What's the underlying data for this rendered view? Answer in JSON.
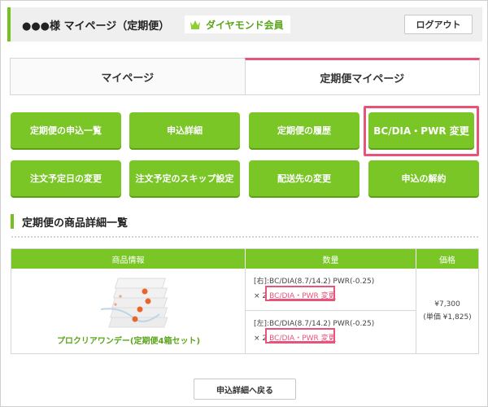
{
  "header": {
    "user_title": "●●●様 マイページ（定期便）",
    "rank_label": "ダイヤモンド会員",
    "rank_icon": "crown-icon",
    "logout_label": "ログアウト"
  },
  "tabs": [
    {
      "label": "マイページ",
      "active": false
    },
    {
      "label": "定期便マイページ",
      "active": true
    }
  ],
  "actions": {
    "row1": [
      "定期便の申込一覧",
      "申込詳細",
      "定期便の履歴",
      "BC/DIA・PWR 変更"
    ],
    "row2": [
      "注文予定日の変更",
      "注文予定のスキップ設定",
      "配送先の変更",
      "申込の解約"
    ]
  },
  "section": {
    "title": "定期便の商品詳細一覧"
  },
  "table": {
    "headers": [
      "商品情報",
      "数量",
      "価格"
    ],
    "product_name": "プロクリアワンデー(定期便4箱セット)",
    "rows": [
      {
        "spec": "[右]:BC/DIA(8.7/14.2) PWR(-0.25)",
        "qty": "× 2",
        "link": "BC/DIA・PWR 変更"
      },
      {
        "spec": "[左]:BC/DIA(8.7/14.2) PWR(-0.25)",
        "qty": "× 2",
        "link": "BC/DIA・PWR 変更"
      }
    ],
    "price": "¥7,300",
    "unit_price": "(単価 ¥1,825)"
  },
  "footer": {
    "back_label": "申込詳細へ戻る"
  },
  "colors": {
    "accent_green": "#7ac627",
    "highlight_pink": "#e8537a"
  }
}
